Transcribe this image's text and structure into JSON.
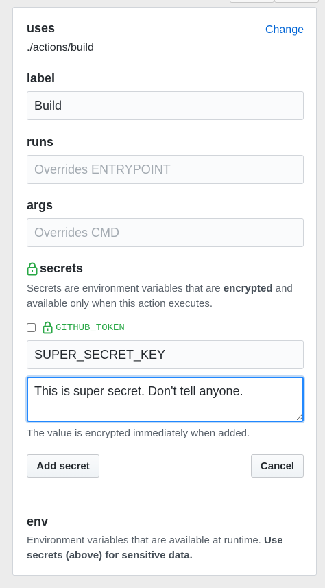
{
  "uses": {
    "label": "uses",
    "value": "./actions/build",
    "change_label": "Change"
  },
  "label_field": {
    "label": "label",
    "value": "Build"
  },
  "runs_field": {
    "label": "runs",
    "placeholder": "Overrides ENTRYPOINT"
  },
  "args_field": {
    "label": "args",
    "placeholder": "Overrides CMD"
  },
  "secrets": {
    "heading": "secrets",
    "desc_before": "Secrets are environment variables that are ",
    "desc_bold": "encrypted",
    "desc_after": " and available only when this action executes.",
    "token_label": "GITHUB_TOKEN",
    "token_checked": false,
    "name_value": "SUPER_SECRET_KEY",
    "secret_value": "This is super secret. Don't tell anyone.",
    "hint": "The value is encrypted immediately when added.",
    "add_label": "Add secret",
    "cancel_label": "Cancel"
  },
  "env": {
    "heading": "env",
    "desc_before": "Environment variables that are available at runtime. ",
    "desc_bold": "Use secrets (above) for sensitive data."
  },
  "colors": {
    "accent": "#0366d6",
    "lock_green": "#28a745",
    "focus_border": "#2188ff"
  },
  "icons": {
    "lock": "lock-icon"
  }
}
